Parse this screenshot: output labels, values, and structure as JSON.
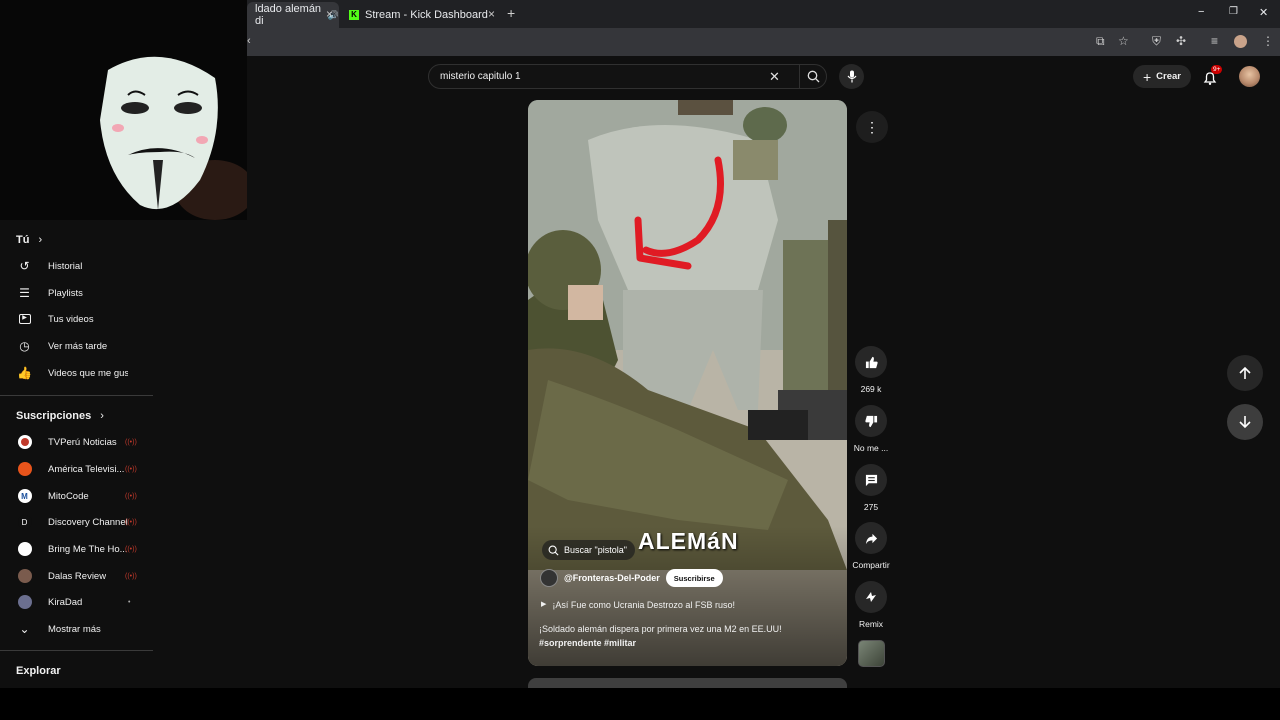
{
  "browser": {
    "tabs": [
      {
        "title": "ldado alemán di",
        "active": true
      },
      {
        "title": "Stream - Kick Dashboard",
        "active": false
      }
    ],
    "new_tab_symbol": "+",
    "window_controls": [
      "−",
      "❐",
      "✕"
    ]
  },
  "header": {
    "search_query": "misterio capitulo 1",
    "create_label": "Crear",
    "notifications_badge": "9+"
  },
  "sidebar": {
    "you_section": {
      "title": "Tú",
      "items": [
        {
          "label": "Historial",
          "icon": "history-icon"
        },
        {
          "label": "Playlists",
          "icon": "playlists-icon"
        },
        {
          "label": "Tus videos",
          "icon": "your-videos-icon"
        },
        {
          "label": "Ver más tarde",
          "icon": "watch-later-icon"
        },
        {
          "label": "Videos que me gus...",
          "icon": "liked-videos-icon"
        }
      ]
    },
    "subscriptions": {
      "title": "Suscripciones",
      "items": [
        {
          "label": "TVPerú Noticias",
          "live": true,
          "color": "#ffffff"
        },
        {
          "label": "América Televisi...",
          "live": true,
          "color": "#e8541b"
        },
        {
          "label": "MitoCode",
          "live": true,
          "color": "#ffffff"
        },
        {
          "label": "Discovery Channel",
          "live": true,
          "color": "#0f0f0f"
        },
        {
          "label": "Bring Me The Ho...",
          "live": true,
          "color": "#ffffff"
        },
        {
          "label": "Dalas Review",
          "live": true,
          "color": "#7a5b4d"
        },
        {
          "label": "KiraDad",
          "live": false,
          "color": "#6b6f8f"
        }
      ],
      "show_more": "Mostrar más"
    },
    "explore_title": "Explorar"
  },
  "short": {
    "search_chip": "Buscar \"pistola\"",
    "overlay_text": "ALEMáN",
    "channel": "@Fronteras-Del-Poder",
    "subscribe_label": "Suscribirse",
    "playlist_line": "¡Así Fue como Ucrania Destrozo al FSB ruso!",
    "description": "¡Soldado alemán dispera por primera vez una M2 en EE.UU!",
    "hashtags": "#sorprendente #militar",
    "likes": "269 k",
    "dislike_label": "No me ...",
    "comments": "275",
    "share_label": "Compartir",
    "remix_label": "Remix"
  },
  "colors": {
    "background": "#0f0f0f",
    "live_red": "#c0392b",
    "badge_red": "#cc0000",
    "arrow_red": "#e01b24"
  }
}
